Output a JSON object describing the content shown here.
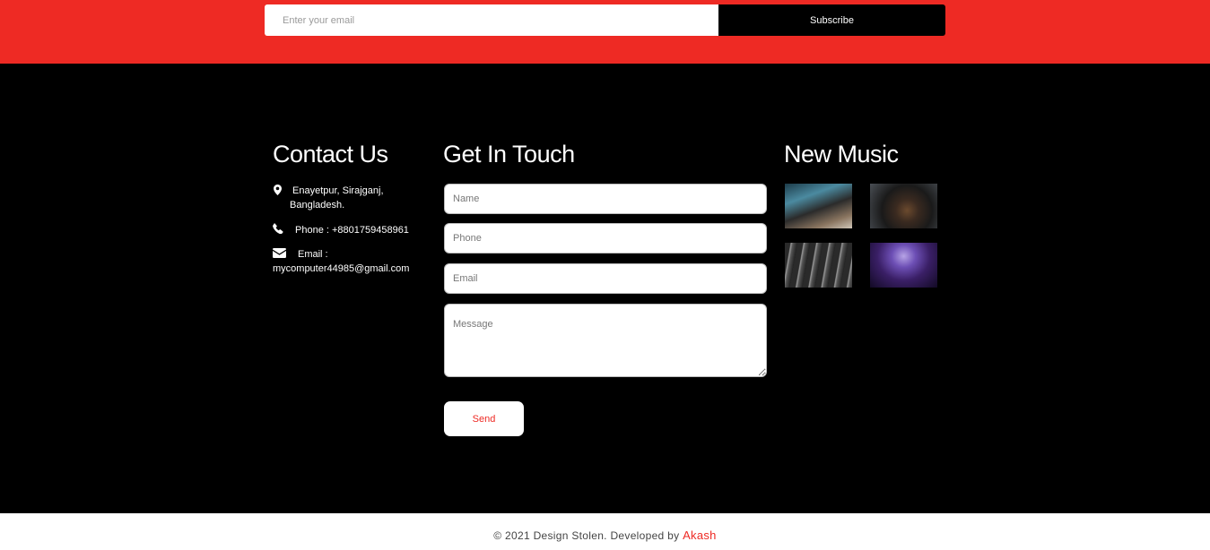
{
  "newsletter": {
    "email_placeholder": "Enter your email",
    "subscribe_label": "Subscribe"
  },
  "contact": {
    "title": "Contact Us",
    "address_line1": "Enayetpur, Sirajganj,",
    "address_line2": "Bangladesh.",
    "phone": "Phone : +8801759458961",
    "email_label": "Email :",
    "email_value": "mycomputer44985@gmail.com"
  },
  "get_in_touch": {
    "title": "Get In Touch",
    "name_placeholder": "Name",
    "phone_placeholder": "Phone",
    "email_placeholder": "Email",
    "message_placeholder": "Message",
    "send_label": "Send"
  },
  "new_music": {
    "title": "New Music",
    "thumbnails": [
      "music-photo-1",
      "music-photo-2",
      "music-photo-3",
      "music-photo-4"
    ]
  },
  "copyright": {
    "text": "© 2021 Design Stolen. Developed by ",
    "author": "Akash"
  },
  "colors": {
    "accent": "#ee2a24",
    "footer_bg": "#000000"
  }
}
